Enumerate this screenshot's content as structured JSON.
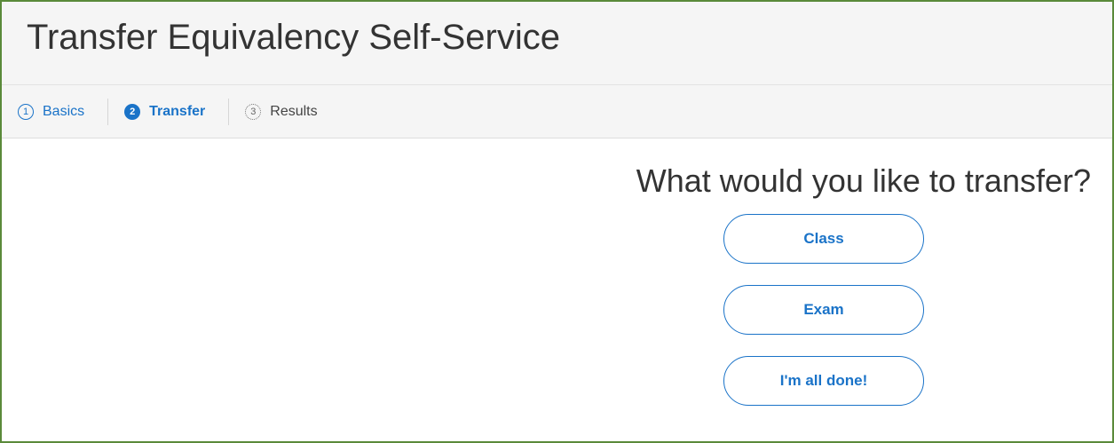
{
  "header": {
    "title": "Transfer Equivalency Self-Service"
  },
  "steps": [
    {
      "number": "1",
      "label": "Basics",
      "state": "completed"
    },
    {
      "number": "2",
      "label": "Transfer",
      "state": "current"
    },
    {
      "number": "3",
      "label": "Results",
      "state": "upcoming"
    }
  ],
  "main": {
    "question": "What would you like to transfer?",
    "choices": [
      {
        "label": "Class"
      },
      {
        "label": "Exam"
      },
      {
        "label": "I'm all done!"
      }
    ]
  },
  "colors": {
    "accent": "#1a73c8",
    "frame_border": "#5a8a3a",
    "header_bg": "#f5f5f5",
    "text": "#333333"
  }
}
